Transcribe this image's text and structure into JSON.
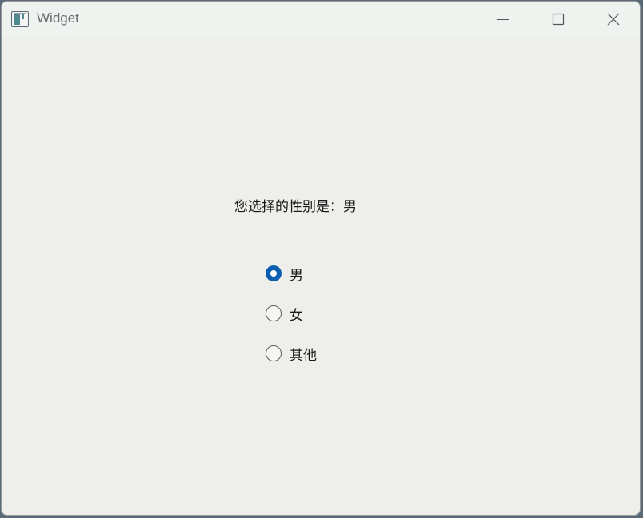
{
  "window": {
    "title": "Widget"
  },
  "main": {
    "status_text": "您选择的性别是：男",
    "options": [
      {
        "label": "男",
        "checked": true
      },
      {
        "label": "女",
        "checked": false
      },
      {
        "label": "其他",
        "checked": false
      }
    ]
  },
  "colors": {
    "accent": "#0a5fb0",
    "window_bg": "#eeeeeb",
    "titlebar_bg": "#eef3ef"
  },
  "icons": {
    "app": "app-window-icon",
    "minimize": "minimize-icon",
    "maximize": "maximize-icon",
    "close": "close-icon"
  }
}
